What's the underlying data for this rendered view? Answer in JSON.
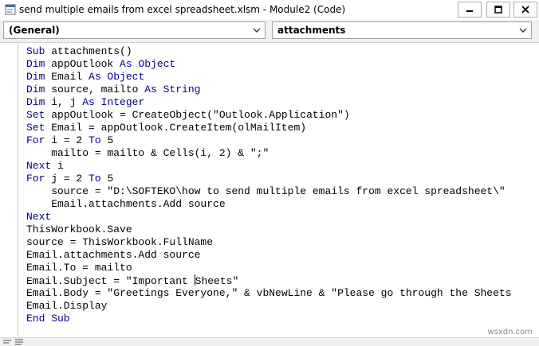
{
  "window": {
    "title": "send multiple emails from excel spreadsheet.xlsm - Module2 (Code)"
  },
  "selectors": {
    "object_value": "(General)",
    "procedure_value": "attachments"
  },
  "code_lines": [
    [
      {
        "t": "Sub ",
        "k": true
      },
      {
        "t": "attachments()",
        "k": false
      }
    ],
    [
      {
        "t": "Dim ",
        "k": true
      },
      {
        "t": "appOutlook ",
        "k": false
      },
      {
        "t": "As Object",
        "k": true
      }
    ],
    [
      {
        "t": "Dim ",
        "k": true
      },
      {
        "t": "Email ",
        "k": false
      },
      {
        "t": "As Object",
        "k": true
      }
    ],
    [
      {
        "t": "Dim ",
        "k": true
      },
      {
        "t": "source, mailto ",
        "k": false
      },
      {
        "t": "As String",
        "k": true
      }
    ],
    [
      {
        "t": "Dim ",
        "k": true
      },
      {
        "t": "i, j ",
        "k": false
      },
      {
        "t": "As Integer",
        "k": true
      }
    ],
    [
      {
        "t": "Set ",
        "k": true
      },
      {
        "t": "appOutlook = CreateObject(\"Outlook.Application\")",
        "k": false
      }
    ],
    [
      {
        "t": "Set ",
        "k": true
      },
      {
        "t": "Email = appOutlook.CreateItem(olMailItem)",
        "k": false
      }
    ],
    [
      {
        "t": "For ",
        "k": true
      },
      {
        "t": "i = 2 ",
        "k": false
      },
      {
        "t": "To ",
        "k": true
      },
      {
        "t": "5",
        "k": false
      }
    ],
    [
      {
        "t": "    mailto = mailto & Cells(i, 2) & \";\"",
        "k": false
      }
    ],
    [
      {
        "t": "Next ",
        "k": true
      },
      {
        "t": "i",
        "k": false
      }
    ],
    [
      {
        "t": "For ",
        "k": true
      },
      {
        "t": "j = 2 ",
        "k": false
      },
      {
        "t": "To ",
        "k": true
      },
      {
        "t": "5",
        "k": false
      }
    ],
    [
      {
        "t": "    source = \"D:\\SOFTEKO\\how to send multiple emails from excel spreadsheet\\\"",
        "k": false
      }
    ],
    [
      {
        "t": "    Email.attachments.Add source",
        "k": false
      }
    ],
    [
      {
        "t": "Next",
        "k": true
      }
    ],
    [
      {
        "t": "ThisWorkbook.Save",
        "k": false
      }
    ],
    [
      {
        "t": "source = ThisWorkbook.FullName",
        "k": false
      }
    ],
    [
      {
        "t": "Email.attachments.Add source",
        "k": false
      }
    ],
    [
      {
        "t": "Email.To = mailto",
        "k": false
      }
    ],
    [
      {
        "t": "Email.Subject = \"Important ",
        "k": false
      },
      {
        "caret": true
      },
      {
        "t": "Sheets\"",
        "k": false
      }
    ],
    [
      {
        "t": "Email.Body = \"Greetings Everyone,\" & vbNewLine & \"Please go through the Sheets",
        "k": false
      }
    ],
    [
      {
        "t": "Email.Display",
        "k": false
      }
    ],
    [
      {
        "t": "End Sub",
        "k": true
      }
    ]
  ],
  "watermark": "wsxdn.com",
  "colors": {
    "keyword": "#00008b",
    "text": "#000000"
  },
  "icons": [
    "vba-module-icon",
    "minimize-icon",
    "maximize-icon",
    "close-icon",
    "chevron-down-icon",
    "procedure-view-icon",
    "module-view-icon"
  ]
}
